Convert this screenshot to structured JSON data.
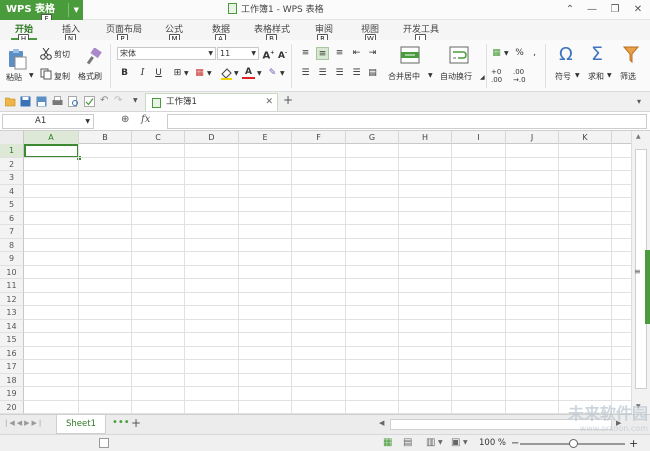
{
  "app": {
    "menu_label": "WPS 表格",
    "keytip": "F"
  },
  "window": {
    "title": "工作簿1 - WPS 表格"
  },
  "tabs": [
    {
      "label": "开始",
      "key": "H"
    },
    {
      "label": "插入",
      "key": "N"
    },
    {
      "label": "页面布局",
      "key": "P"
    },
    {
      "label": "公式",
      "key": "M"
    },
    {
      "label": "数据",
      "key": "A"
    },
    {
      "label": "表格样式",
      "key": "B"
    },
    {
      "label": "审阅",
      "key": "R"
    },
    {
      "label": "视图",
      "key": "W"
    },
    {
      "label": "开发工具",
      "key": "L"
    }
  ],
  "ribbon": {
    "paste": "粘贴",
    "cut": "剪切",
    "copy": "复制",
    "format_painter": "格式刷",
    "font_name": "宋体",
    "font_size": "11",
    "merge_center": "合并居中",
    "wrap_text": "自动换行",
    "percent": "%",
    "comma": ",",
    "inc_decimal": ".00→.0",
    "symbol": "符号",
    "sum": "求和",
    "filter": "筛选"
  },
  "document_tab": {
    "label": "工作簿1"
  },
  "formula_bar": {
    "cell_ref": "A1",
    "fx": "fx",
    "value": ""
  },
  "columns": [
    "A",
    "B",
    "C",
    "D",
    "E",
    "F",
    "G",
    "H",
    "I",
    "J",
    "K"
  ],
  "rows": [
    "1",
    "2",
    "3",
    "4",
    "5",
    "6",
    "7",
    "8",
    "9",
    "10",
    "11",
    "12",
    "13",
    "14",
    "15",
    "16",
    "17",
    "18",
    "19",
    "20"
  ],
  "selected_cell": "A1",
  "sheets": [
    {
      "name": "Sheet1",
      "active": true
    }
  ],
  "status": {
    "zoom": "100 %"
  },
  "watermark": {
    "text": "未来软件园",
    "sub": "www.orsoon.com"
  },
  "colors": {
    "accent": "#4a9b3b",
    "accent_dark": "#2f7a24"
  }
}
